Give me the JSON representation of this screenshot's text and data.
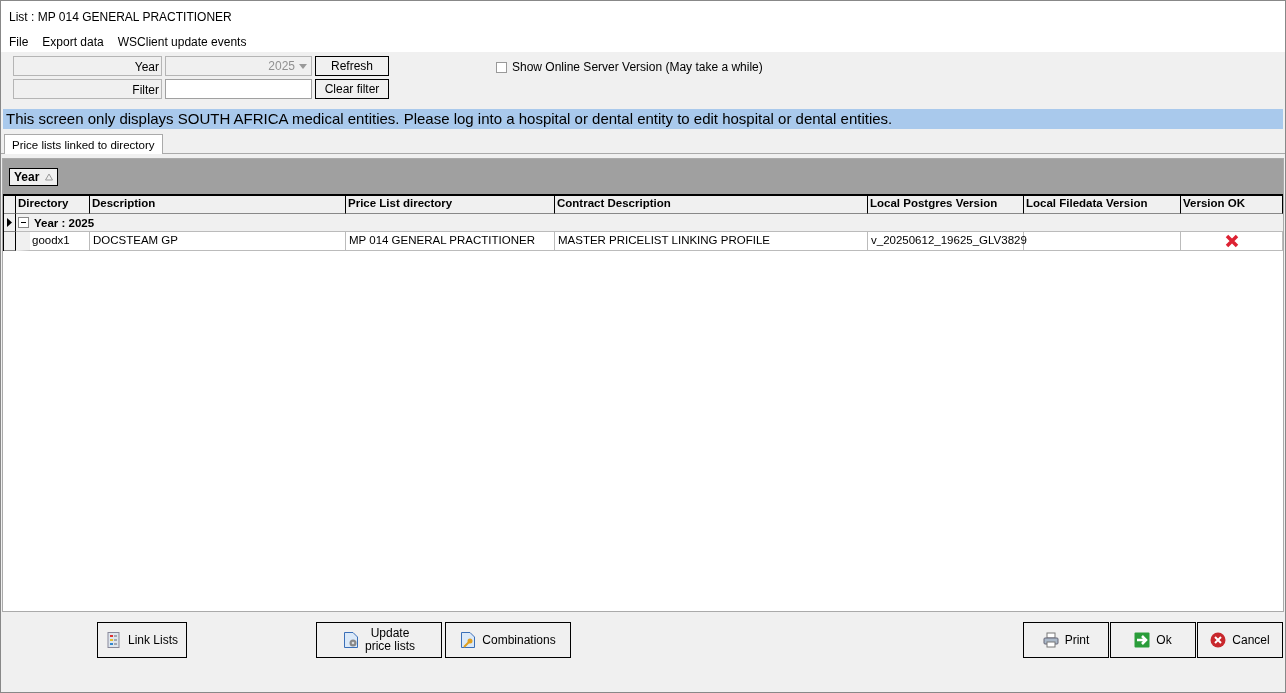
{
  "window": {
    "title": "List : MP 014 GENERAL PRACTITIONER"
  },
  "menu": [
    "File",
    "Export data",
    "WSClient update events"
  ],
  "filters": {
    "year_label": "Year",
    "year_value": "2025",
    "filter_label": "Filter",
    "refresh": "Refresh",
    "clear": "Clear filter",
    "online_checkbox": {
      "label": "Show Online Server Version (May take a while)",
      "checked": false
    }
  },
  "notice": "This screen only displays SOUTH AFRICA medical entities. Please log into a hospital or dental entity to edit hospital or dental entities.",
  "tabs": [
    {
      "label": "Price lists linked to directory",
      "selected": true
    }
  ],
  "group_by": {
    "label": "Year"
  },
  "table": {
    "columns": [
      "Directory",
      "Description",
      "Price List directory",
      "Contract Description",
      "Local Postgres Version",
      "Local Filedata Version",
      "Version OK"
    ],
    "groups": [
      {
        "label": "Year : 2025",
        "expanded": true,
        "current": true,
        "rows": [
          {
            "cells": [
              "goodx1",
              "DOCSTEAM GP",
              "MP 014 GENERAL PRACTITIONER",
              "MASTER PRICELIST LINKING PROFILE",
              "v_20250612_19625_GLV3829",
              ""
            ],
            "version_ok": false
          }
        ]
      }
    ]
  },
  "buttons": [
    {
      "kind": "link",
      "label": "Link Lists"
    },
    {
      "kind": "update",
      "label": "Update\nprice lists"
    },
    {
      "kind": "combinations",
      "label": "Combinations"
    },
    {
      "kind": "print",
      "label": "Print"
    },
    {
      "kind": "ok",
      "label": "Ok"
    },
    {
      "kind": "cancel",
      "label": "Cancel"
    }
  ]
}
